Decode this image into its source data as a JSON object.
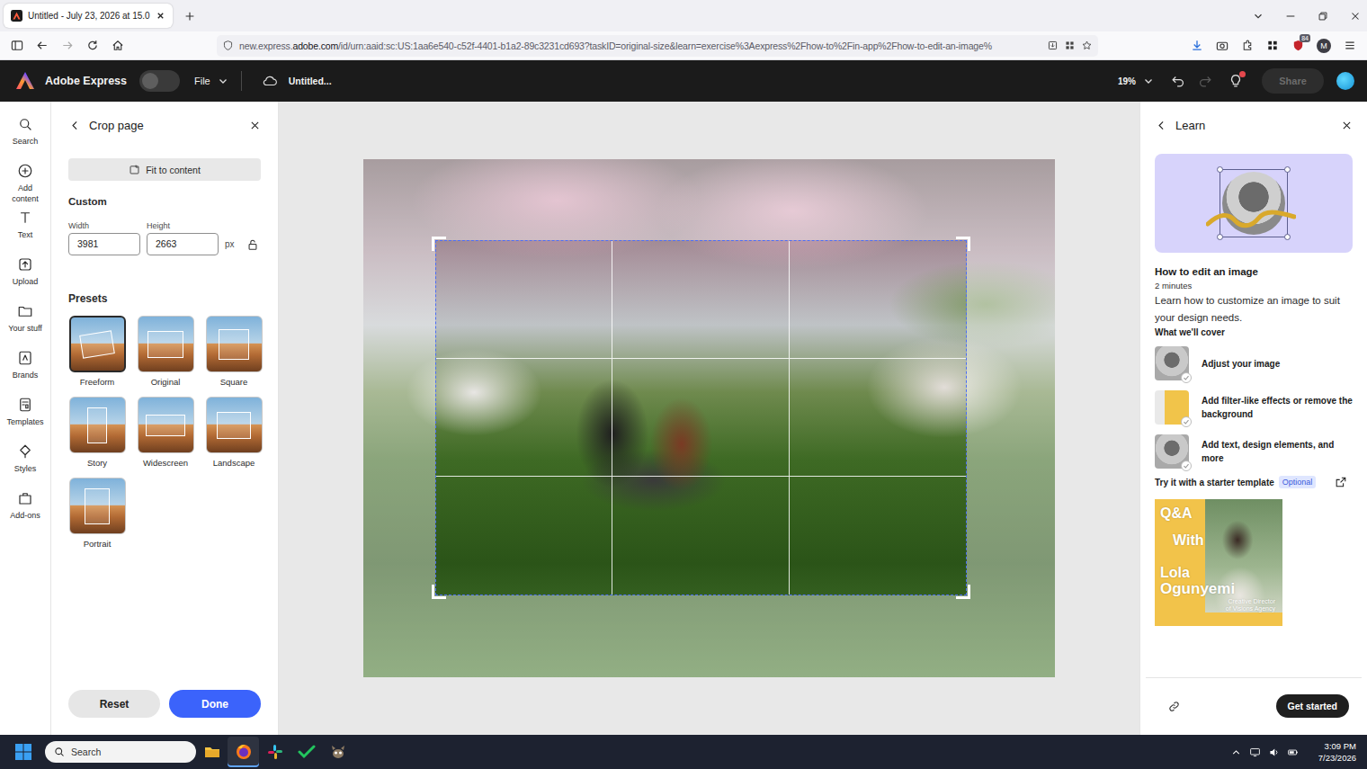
{
  "browser": {
    "tabs": [
      {
        "title": "Untitled - July 23, 2026 at 15.0",
        "selected": true
      }
    ],
    "url": {
      "prefix": "new.express.",
      "domain": "adobe.com",
      "path": "/id/urn:aaid:sc:US:1aa6e540-c52f-4401-b1a2-89c3231cd693?taskID=original-size&learn=exercise%3Aexpress%2Fhow-to%2Fin-app%2Fhow-to-edit-an-image%"
    },
    "extension_badge": "84",
    "profile_initial": "M"
  },
  "app_header": {
    "brand": "Adobe Express",
    "menu": "File",
    "document_title": "Untitled...",
    "zoom": "19%",
    "redo_disabled": true,
    "notification": true,
    "share": {
      "label": "Share",
      "disabled": true
    }
  },
  "rail": {
    "items": [
      {
        "label": "Search",
        "selected": false
      },
      {
        "label": "Add content",
        "selected": false
      },
      {
        "label": "Text",
        "selected": false
      },
      {
        "label": "Upload",
        "selected": false
      },
      {
        "label": "Your stuff",
        "selected": false
      },
      {
        "label": "Brands",
        "selected": false
      },
      {
        "label": "Templates",
        "selected": false
      },
      {
        "label": "Styles",
        "selected": false
      },
      {
        "label": "Add-ons",
        "selected": false
      }
    ]
  },
  "crop_panel": {
    "title": "Crop page",
    "fit_button": "Fit to content",
    "section": "Custom",
    "width": {
      "label": "Width",
      "value": "3981"
    },
    "height": {
      "label": "Height",
      "value": "2663"
    },
    "unit": "px",
    "locked": false,
    "presets_title": "Presets",
    "presets": [
      {
        "label": "Freeform",
        "selected": true
      },
      {
        "label": "Original",
        "selected": false
      },
      {
        "label": "Square",
        "selected": false
      },
      {
        "label": "Story",
        "selected": false
      },
      {
        "label": "Widescreen",
        "selected": false
      },
      {
        "label": "Landscape",
        "selected": false
      },
      {
        "label": "Portrait",
        "selected": false
      }
    ],
    "buttons": {
      "reset": "Reset",
      "done": "Done"
    }
  },
  "learn_panel": {
    "title": "Learn",
    "lesson": {
      "title": "How to edit an image",
      "duration": "2 minutes",
      "description": "Learn how to customize an image to suit your design needs.",
      "cover_heading": "What we'll cover",
      "steps": [
        {
          "label": "Adjust your image",
          "done": false
        },
        {
          "label": "Add filter-like effects or remove the background",
          "done": false
        },
        {
          "label": "Add text, design elements, and more",
          "done": false
        }
      ]
    },
    "template": {
      "heading": "Try it with a starter template",
      "badge": "Optional",
      "lines": [
        "Q&A",
        "With",
        "Lola",
        "Ogunyemi"
      ],
      "subtitle": [
        "Creative Director",
        "of Visions Agency"
      ]
    },
    "action": "Get started"
  },
  "taskbar": {
    "search": "Search",
    "apps": [
      {
        "active": false
      },
      {
        "active": true
      },
      {
        "active": false
      },
      {
        "active": false
      },
      {
        "active": false
      }
    ],
    "time": "3:09 PM",
    "date": "7/23/2026"
  }
}
